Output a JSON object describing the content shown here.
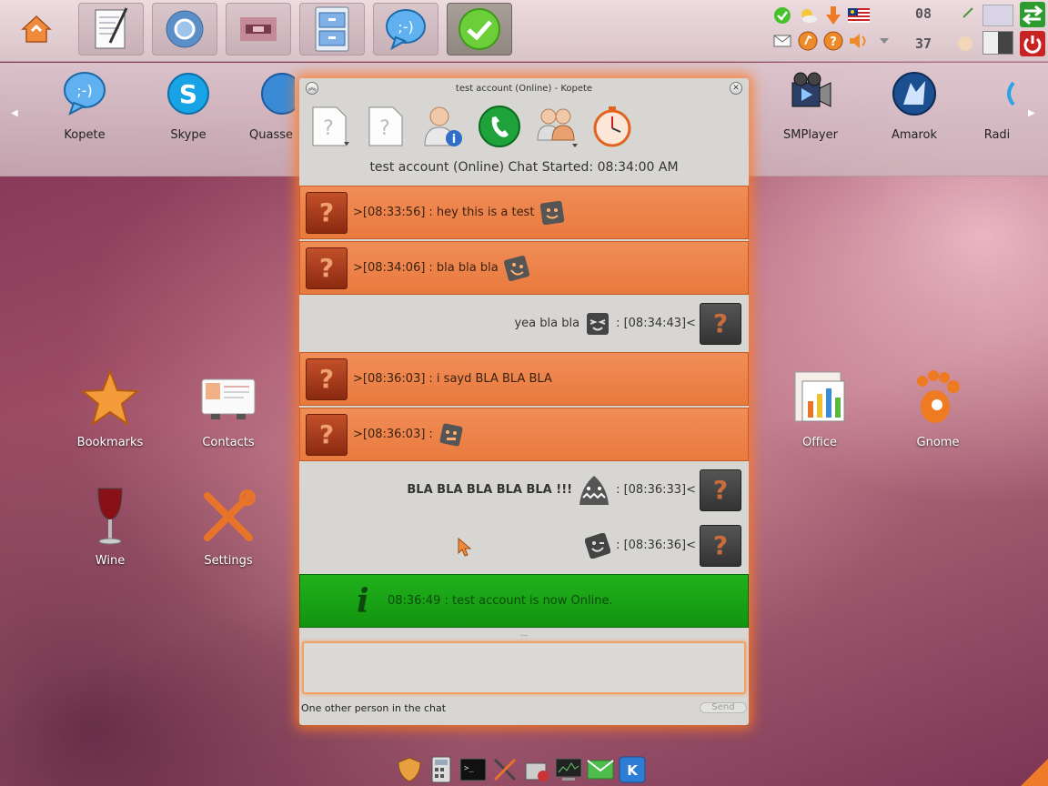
{
  "launcher": {
    "items": [
      {
        "label": "Kopete",
        "icon": "kopete-icon"
      },
      {
        "label": "Skype",
        "icon": "skype-icon"
      },
      {
        "label": "Quasse",
        "icon": "quassel-icon"
      },
      {
        "label": "SMPlayer",
        "icon": "smplayer-icon"
      },
      {
        "label": "Amarok",
        "icon": "amarok-icon"
      },
      {
        "label": "Radi",
        "icon": "radio-icon"
      }
    ]
  },
  "clock": {
    "hour": "08",
    "minute": "37"
  },
  "desktop": {
    "icons": [
      {
        "label": "Bookmarks",
        "icon": "star-icon"
      },
      {
        "label": "Contacts",
        "icon": "contacts-card-icon"
      },
      {
        "label": "Wine",
        "icon": "wine-glass-icon"
      },
      {
        "label": "Settings",
        "icon": "tools-icon"
      },
      {
        "label": "Office",
        "icon": "office-chart-icon"
      },
      {
        "label": "Gnome",
        "icon": "gnome-foot-icon"
      }
    ]
  },
  "kopete": {
    "title": "test account (Online) - Kopete",
    "chat_started": "test account (Online) Chat Started: 08:34:00 AM",
    "messages": [
      {
        "direction": "in",
        "time": ">[08:33:56]",
        "text": ": hey this is a test",
        "emoticon": "smile-emoticon"
      },
      {
        "direction": "in",
        "time": ">[08:34:06]",
        "text": ": bla bla bla",
        "emoticon": "grin-emoticon"
      },
      {
        "direction": "out",
        "text": "yea bla bla",
        "time": ": [08:34:43]<",
        "emoticon": "laugh-emoticon"
      },
      {
        "direction": "in",
        "time": ">[08:36:03]",
        "text": ": i sayd BLA BLA BLA",
        "emoticon": ""
      },
      {
        "direction": "in",
        "time": ">[08:36:03]",
        "text": ":",
        "emoticon": "robot-emoticon"
      },
      {
        "direction": "out",
        "text": "BLA BLA BLA BLA BLA !!!",
        "time": ": [08:36:33]<",
        "emoticon": "shark-emoticon"
      },
      {
        "direction": "out",
        "text": "",
        "time": ": [08:36:36]<",
        "emoticon": "wink-emoticon"
      }
    ],
    "status_message": {
      "icon": "info-icon",
      "text": "08:36:49 : test account is now Online."
    },
    "resize_dots": "...",
    "status_line": "One other person in the chat",
    "send_label": "Send"
  },
  "colors": {
    "incoming": "#ec8447",
    "status_green": "#1aa315",
    "window_glow": "#ff7a1e"
  }
}
